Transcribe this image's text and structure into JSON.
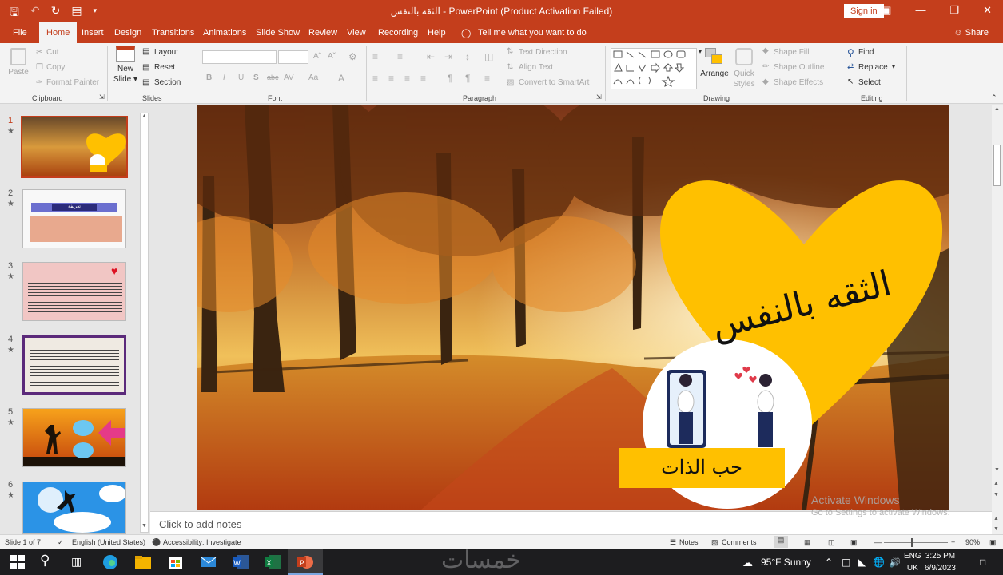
{
  "window": {
    "title": "الثقه بالنفس  -  PowerPoint (Product Activation Failed)",
    "sign_in": "Sign in",
    "qat_icons": [
      "save-icon",
      "undo-icon",
      "redo-icon",
      "present-icon"
    ]
  },
  "menu": {
    "items": [
      "File",
      "Home",
      "Insert",
      "Design",
      "Transitions",
      "Animations",
      "Slide Show",
      "Review",
      "View",
      "Recording",
      "Help"
    ],
    "tell_me": "Tell me what you want to do",
    "share": "Share",
    "active": "Home"
  },
  "ribbon": {
    "clipboard": {
      "paste": "Paste",
      "cut": "Cut",
      "copy": "Copy",
      "format_painter": "Format Painter",
      "label": "Clipboard"
    },
    "slides": {
      "new_slide_1": "New",
      "new_slide_2": "Slide",
      "layout": "Layout",
      "reset": "Reset",
      "section": "Section",
      "label": "Slides"
    },
    "font": {
      "label": "Font",
      "bold": "B",
      "italic": "I",
      "underline": "U",
      "shadow": "S",
      "strike": "abc",
      "spacing": "AV",
      "case": "Aa",
      "color": "A"
    },
    "paragraph": {
      "text_direction": "Text Direction",
      "align_text": "Align Text",
      "convert_smartart": "Convert to SmartArt",
      "label": "Paragraph"
    },
    "drawing": {
      "arrange": "Arrange",
      "quick_styles_1": "Quick",
      "quick_styles_2": "Styles",
      "shape_fill": "Shape Fill",
      "shape_outline": "Shape Outline",
      "shape_effects": "Shape Effects",
      "label": "Drawing"
    },
    "editing": {
      "find": "Find",
      "replace": "Replace",
      "select": "Select",
      "label": "Editing"
    }
  },
  "thumbnails": [
    {
      "num": "1",
      "star": "★"
    },
    {
      "num": "2",
      "star": "★",
      "banner": "تعريفة"
    },
    {
      "num": "3",
      "star": "★"
    },
    {
      "num": "4",
      "star": "★"
    },
    {
      "num": "5",
      "star": "★"
    },
    {
      "num": "6",
      "star": "★"
    }
  ],
  "slide": {
    "title": "الثقه بالنفس",
    "subtitle": "حب الذات"
  },
  "notes_placeholder": "Click to add notes",
  "activation": {
    "line1": "Activate Windows",
    "line2": "Go to Settings to activate Windows."
  },
  "status": {
    "slide": "Slide 1 of 7",
    "language": "English (United States)",
    "accessibility": "Accessibility: Investigate",
    "notes": "Notes",
    "comments": "Comments",
    "zoom": "90%"
  },
  "taskbar": {
    "weather": "95°F  Sunny",
    "lang_1": "ENG",
    "lang_2": "UK",
    "time": "3:25 PM",
    "date": "6/9/2023",
    "logo": "خمسات"
  },
  "colors": {
    "accent": "#c43e1c",
    "heart": "#ffc000"
  }
}
